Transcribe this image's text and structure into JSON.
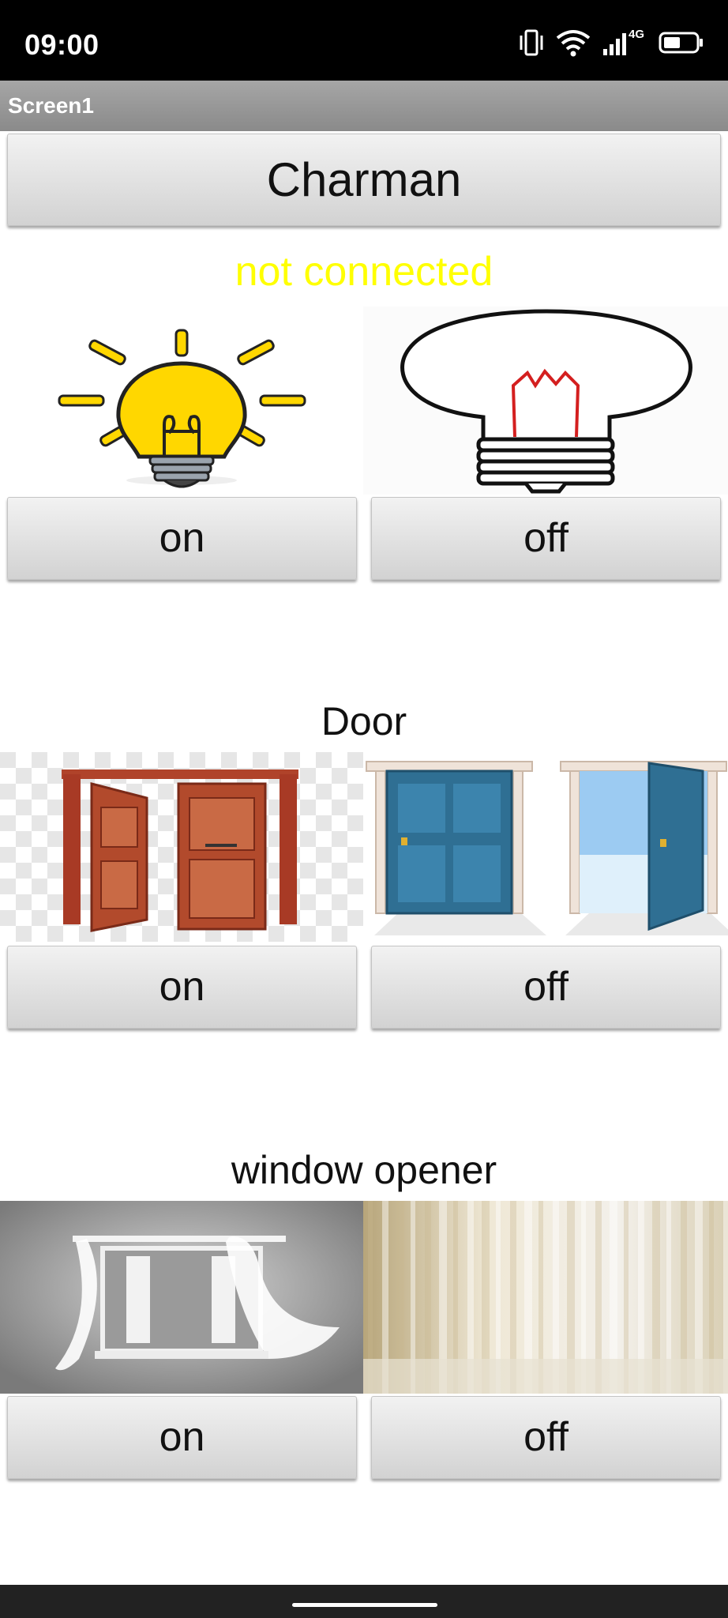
{
  "status_bar": {
    "time": "09:00",
    "network": "4G"
  },
  "app": {
    "screen_title": "Screen1"
  },
  "header_button": {
    "label": "Charman"
  },
  "connection_status": {
    "text": "not connected",
    "color": "#ffff00"
  },
  "sections": [
    {
      "title": "",
      "on_label": "on",
      "off_label": "off"
    },
    {
      "title": "Door",
      "on_label": "on",
      "off_label": "off"
    },
    {
      "title": "window opener",
      "on_label": "on",
      "off_label": "off"
    }
  ],
  "icons": [
    "vibrate-icon",
    "wifi-icon",
    "signal-icon",
    "battery-icon"
  ]
}
